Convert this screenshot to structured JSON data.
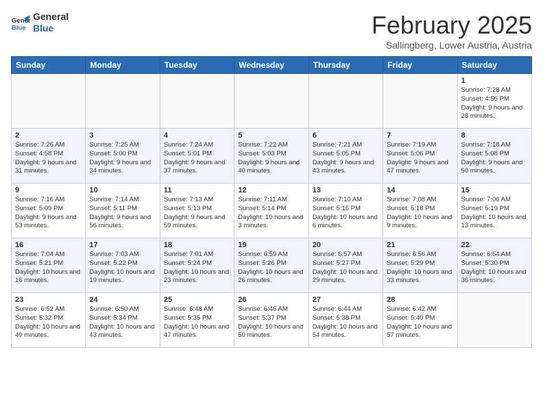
{
  "header": {
    "logo_line1": "General",
    "logo_line2": "Blue",
    "title": "February 2025",
    "subtitle": "Sallingberg, Lower Austria, Austria"
  },
  "days_of_week": [
    "Sunday",
    "Monday",
    "Tuesday",
    "Wednesday",
    "Thursday",
    "Friday",
    "Saturday"
  ],
  "weeks": [
    [
      {
        "day": "",
        "info": ""
      },
      {
        "day": "",
        "info": ""
      },
      {
        "day": "",
        "info": ""
      },
      {
        "day": "",
        "info": ""
      },
      {
        "day": "",
        "info": ""
      },
      {
        "day": "",
        "info": ""
      },
      {
        "day": "1",
        "info": "Sunrise: 7:28 AM\nSunset: 4:56 PM\nDaylight: 9 hours and 28 minutes."
      }
    ],
    [
      {
        "day": "2",
        "info": "Sunrise: 7:26 AM\nSunset: 4:58 PM\nDaylight: 9 hours and 31 minutes."
      },
      {
        "day": "3",
        "info": "Sunrise: 7:25 AM\nSunset: 5:00 PM\nDaylight: 9 hours and 34 minutes."
      },
      {
        "day": "4",
        "info": "Sunrise: 7:24 AM\nSunset: 5:01 PM\nDaylight: 9 hours and 37 minutes."
      },
      {
        "day": "5",
        "info": "Sunrise: 7:22 AM\nSunset: 5:03 PM\nDaylight: 9 hours and 40 minutes."
      },
      {
        "day": "6",
        "info": "Sunrise: 7:21 AM\nSunset: 5:05 PM\nDaylight: 9 hours and 43 minutes."
      },
      {
        "day": "7",
        "info": "Sunrise: 7:19 AM\nSunset: 5:06 PM\nDaylight: 9 hours and 47 minutes."
      },
      {
        "day": "8",
        "info": "Sunrise: 7:18 AM\nSunset: 5:08 PM\nDaylight: 9 hours and 50 minutes."
      }
    ],
    [
      {
        "day": "9",
        "info": "Sunrise: 7:16 AM\nSunset: 5:09 PM\nDaylight: 9 hours and 53 minutes."
      },
      {
        "day": "10",
        "info": "Sunrise: 7:14 AM\nSunset: 5:11 PM\nDaylight: 9 hours and 56 minutes."
      },
      {
        "day": "11",
        "info": "Sunrise: 7:13 AM\nSunset: 5:13 PM\nDaylight: 9 hours and 59 minutes."
      },
      {
        "day": "12",
        "info": "Sunrise: 7:11 AM\nSunset: 5:14 PM\nDaylight: 10 hours and 3 minutes."
      },
      {
        "day": "13",
        "info": "Sunrise: 7:10 AM\nSunset: 5:16 PM\nDaylight: 10 hours and 6 minutes."
      },
      {
        "day": "14",
        "info": "Sunrise: 7:08 AM\nSunset: 5:18 PM\nDaylight: 10 hours and 9 minutes."
      },
      {
        "day": "15",
        "info": "Sunrise: 7:06 AM\nSunset: 5:19 PM\nDaylight: 10 hours and 13 minutes."
      }
    ],
    [
      {
        "day": "16",
        "info": "Sunrise: 7:04 AM\nSunset: 5:21 PM\nDaylight: 10 hours and 16 minutes."
      },
      {
        "day": "17",
        "info": "Sunrise: 7:03 AM\nSunset: 5:22 PM\nDaylight: 10 hours and 19 minutes."
      },
      {
        "day": "18",
        "info": "Sunrise: 7:01 AM\nSunset: 5:24 PM\nDaylight: 10 hours and 23 minutes."
      },
      {
        "day": "19",
        "info": "Sunrise: 6:59 AM\nSunset: 5:26 PM\nDaylight: 10 hours and 26 minutes."
      },
      {
        "day": "20",
        "info": "Sunrise: 6:57 AM\nSunset: 5:27 PM\nDaylight: 10 hours and 29 minutes."
      },
      {
        "day": "21",
        "info": "Sunrise: 6:56 AM\nSunset: 5:29 PM\nDaylight: 10 hours and 33 minutes."
      },
      {
        "day": "22",
        "info": "Sunrise: 6:54 AM\nSunset: 5:30 PM\nDaylight: 10 hours and 36 minutes."
      }
    ],
    [
      {
        "day": "23",
        "info": "Sunrise: 6:52 AM\nSunset: 5:32 PM\nDaylight: 10 hours and 40 minutes."
      },
      {
        "day": "24",
        "info": "Sunrise: 6:50 AM\nSunset: 5:34 PM\nDaylight: 10 hours and 43 minutes."
      },
      {
        "day": "25",
        "info": "Sunrise: 6:48 AM\nSunset: 5:35 PM\nDaylight: 10 hours and 47 minutes."
      },
      {
        "day": "26",
        "info": "Sunrise: 6:46 AM\nSunset: 5:37 PM\nDaylight: 10 hours and 50 minutes."
      },
      {
        "day": "27",
        "info": "Sunrise: 6:44 AM\nSunset: 5:38 PM\nDaylight: 10 hours and 54 minutes."
      },
      {
        "day": "28",
        "info": "Sunrise: 6:42 AM\nSunset: 5:40 PM\nDaylight: 10 hours and 57 minutes."
      },
      {
        "day": "",
        "info": ""
      }
    ]
  ]
}
